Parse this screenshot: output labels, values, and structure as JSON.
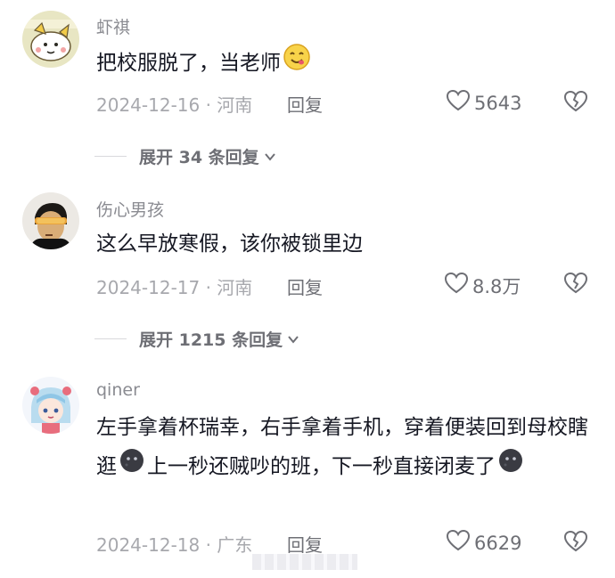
{
  "comments": [
    {
      "username": "虾祺",
      "text": "把校服脱了，当老师",
      "date_location": "2024-12-16 · 河南",
      "reply_label": "回复",
      "likes": "5643",
      "expand_label": "展开 34 条回复"
    },
    {
      "username": "伤心男孩",
      "text": "这么早放寒假，该你被锁里边",
      "date_location": "2024-12-17 · 河南",
      "reply_label": "回复",
      "likes": "8.8万",
      "expand_label": "展开 1215 条回复"
    },
    {
      "username": "qiner",
      "text_part1": "左手拿着杯瑞幸，右手拿着手机，穿着便装回到母校瞎逛",
      "text_part2": "上一秒还贼吵的班，下一秒直接闭麦了",
      "date_location": "2024-12-18 · 广东",
      "reply_label": "回复",
      "likes": "6629"
    }
  ],
  "colors": {
    "text": "#161823",
    "secondary": "#8a8b91",
    "meta": "#a7a8ad"
  },
  "icons": {
    "like": "heart-outline-icon",
    "dislike": "broken-heart-icon",
    "expand": "chevron-down-icon",
    "emoji_1": "yum-emoji",
    "emoji_2": "dark-moon-face-emoji"
  }
}
